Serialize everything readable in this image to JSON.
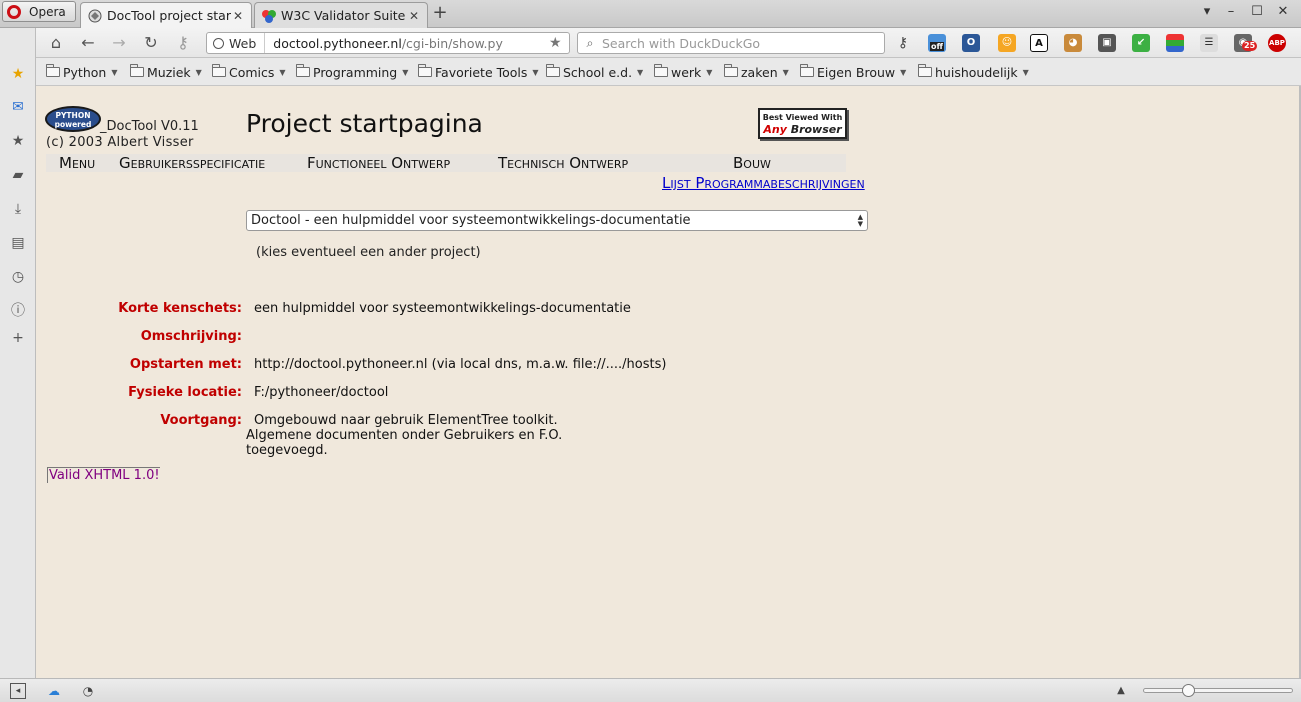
{
  "browser": {
    "menu_button": "Opera",
    "tabs": [
      {
        "title": "DocTool project start",
        "close": "✕"
      },
      {
        "title": "W3C Validator Suite",
        "close": "✕"
      }
    ],
    "new_tab": "+",
    "window_controls": {
      "menu": "▾",
      "minimize": "–",
      "maximize": "☐",
      "close": "✕"
    }
  },
  "addressbar": {
    "badge": "Web",
    "url_domain": "doctool.pythoneer.nl",
    "url_path": "/cgi-bin/show.py",
    "search_placeholder": "Search with DuckDuckGo",
    "extension_badges": {
      "off": "off",
      "count": "25",
      "abp": "ABP",
      "font": "A"
    }
  },
  "bookmarks": [
    "Python",
    "Muziek",
    "Comics",
    "Programming",
    "Favoriete Tools",
    "School e.d.",
    "werk",
    "zaken",
    "Eigen Brouw",
    "huishoudelijk"
  ],
  "page": {
    "logo_text": "PYTHON powered",
    "doctool_version": "_DocTool V0.11",
    "copyright": "(c) 2003 Albert Visser",
    "title": "Project startpagina",
    "any_browser": {
      "line1": "Best Viewed With",
      "any": "Any",
      "browser": " Browser"
    },
    "menu": {
      "menu": "Menu",
      "gebruikers": "Gebruikersspecificatie",
      "functioneel": "Functioneel Ontwerp",
      "technisch": "Technisch Ontwerp",
      "bouw": "Bouw",
      "programmabeschrijvingen": "Lijst Programmabeschrijvingen"
    },
    "project_select": "Doctool - een hulpmiddel voor systeemontwikkelings-documentatie",
    "select_hint": "(kies eventueel een ander project)",
    "fields": {
      "kenschets_label": "Korte kenschets:",
      "kenschets_value": "een hulpmiddel voor systeemontwikkelings-documentatie",
      "omschrijving_label": "Omschrijving:",
      "opstarten_label": "Opstarten met:",
      "opstarten_value": "http://doctool.pythoneer.nl (via local dns, m.a.w. file://..../hosts)",
      "locatie_label": "Fysieke locatie:",
      "locatie_value": "F:/pythoneer/doctool",
      "voortgang_label": "Voortgang:",
      "voortgang_value": "Omgebouwd naar gebruik ElementTree toolkit. Algemene documenten onder Gebruikers en F.O. toegevoegd."
    },
    "valid_link": "Valid XHTML 1.0!"
  },
  "statusbar": {
    "zoom_fraction": 0.28
  },
  "colors": {
    "page_bg": "#f0e8dc",
    "label_red": "#c00000",
    "link_blue": "#0000cc",
    "visited_purple": "#800080",
    "opera_red": "#cc0f16"
  }
}
